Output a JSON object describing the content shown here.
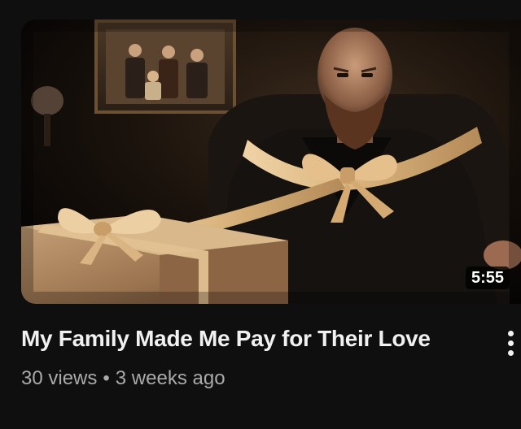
{
  "video": {
    "thumbnail_icon": "video-thumbnail",
    "duration": "5:55",
    "title": "My Family Made Me Pay for Their Love",
    "views": "30 views",
    "separator": "•",
    "age": "3 weeks ago",
    "menu_icon": "more-vertical-icon"
  },
  "colors": {
    "background": "#0f0f0f",
    "title": "#f1f1f1",
    "meta": "#aaaaaa",
    "ribbon": "#d8b27a"
  }
}
